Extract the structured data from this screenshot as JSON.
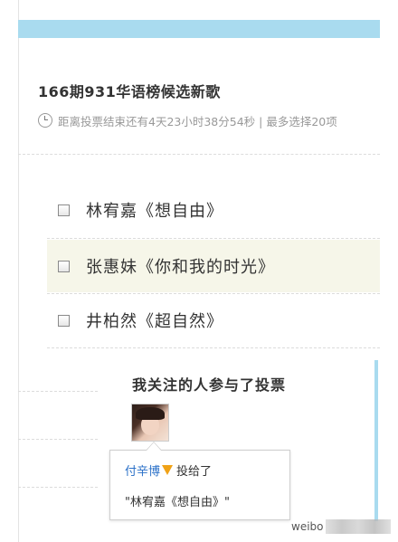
{
  "poll": {
    "title": "166期931华语榜候选新歌",
    "countdown": "距离投票结束还有4天23小时38分54秒 | 最多选择20项",
    "options": [
      {
        "label": "林宥嘉《想自由》",
        "checked": false
      },
      {
        "label": "张惠妹《你和我的时光》",
        "checked": false
      },
      {
        "label": "井柏然《超自然》",
        "checked": false
      }
    ]
  },
  "following": {
    "title": "我关注的人参与了投票",
    "voter_name": "付辛博",
    "voter_badge": "vip-v-icon",
    "voted_text": "投给了",
    "vote_choice": "\"林宥嘉《想自由》\""
  },
  "watermark": "weibo",
  "colors": {
    "accent_bar": "#a9dbef",
    "link": "#2a70c8",
    "vip_badge": "#f0a216",
    "highlight_row": "#f6f6e9"
  }
}
